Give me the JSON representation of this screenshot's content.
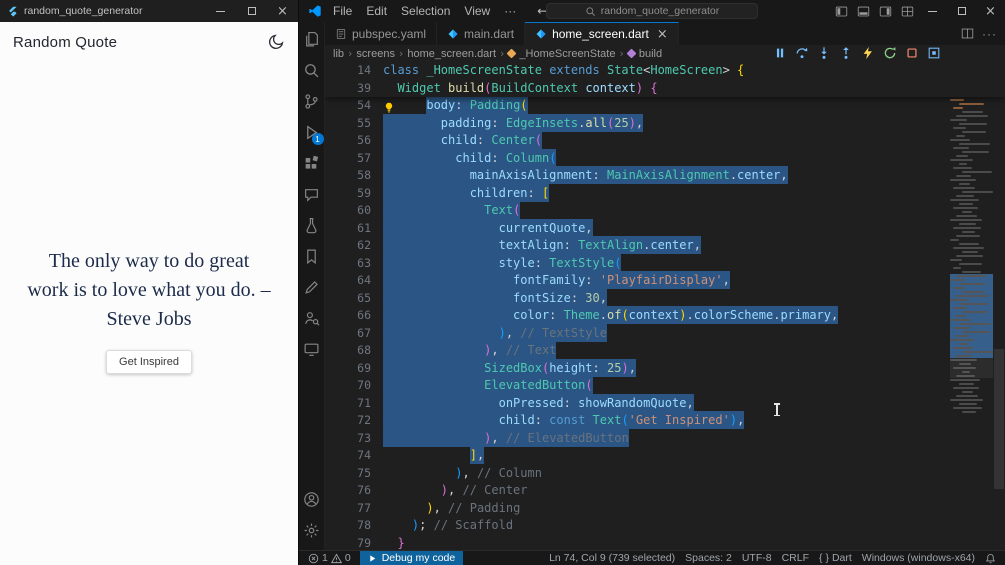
{
  "app_window": {
    "title": "random_quote_generator",
    "header_title": "Random Quote",
    "quote_lines": [
      "The only way to do great",
      "work is to love what you do. –",
      "Steve Jobs"
    ],
    "button_label": "Get Inspired"
  },
  "vscode": {
    "menus": [
      "File",
      "Edit",
      "Selection",
      "View",
      "···"
    ],
    "search_value": "random_quote_generator",
    "debug_badge": "1",
    "tabs": [
      {
        "label": "pubspec.yaml"
      },
      {
        "label": "main.dart"
      },
      {
        "label": "home_screen.dart"
      }
    ],
    "breadcrumbs": [
      "lib",
      "screens",
      "home_screen.dart",
      "_HomeScreenState",
      "build"
    ],
    "editor": {
      "syntax_colors": {
        "kw": "#569cd6",
        "ty": "#4ec9b0",
        "pr": "#9cdcfe",
        "fn": "#dcdcaa",
        "st": "#ce9178",
        "nu": "#b5cea8",
        "pu": "#d4d4d4",
        "b1": "#ffd700",
        "b2": "#da70d6",
        "b3": "#179fff",
        "cm": "#6a737d"
      },
      "sticky": [
        {
          "n": 14,
          "i": 0,
          "sel": 0,
          "t": [
            [
              "kw",
              "class "
            ],
            [
              "ty",
              "_HomeScreenState "
            ],
            [
              "kw",
              "extends "
            ],
            [
              "ty",
              "State"
            ],
            [
              "pu",
              "<"
            ],
            [
              "ty",
              "HomeScreen"
            ],
            [
              "pu",
              "> "
            ],
            [
              "b1",
              "{"
            ]
          ]
        },
        {
          "n": 39,
          "i": 2,
          "sel": 0,
          "t": [
            [
              "ty",
              "Widget "
            ],
            [
              "fn",
              "build"
            ],
            [
              "b2",
              "("
            ],
            [
              "ty",
              "BuildContext "
            ],
            [
              "pr",
              "context"
            ],
            [
              "b2",
              ") "
            ],
            [
              "b2",
              "{"
            ]
          ]
        }
      ],
      "lines": [
        {
          "n": 54,
          "i": 6,
          "sel": 2,
          "t": [
            [
              "pr",
              "body"
            ],
            [
              "pu",
              ": "
            ],
            [
              "ty",
              "Padding"
            ],
            [
              "b1",
              "("
            ]
          ]
        },
        {
          "n": 55,
          "i": 8,
          "sel": 1,
          "t": [
            [
              "pr",
              "padding"
            ],
            [
              "pu",
              ": "
            ],
            [
              "ty",
              "EdgeInsets"
            ],
            [
              "pu",
              "."
            ],
            [
              "fn",
              "all"
            ],
            [
              "b2",
              "("
            ],
            [
              "nu",
              "25"
            ],
            [
              "b2",
              ")"
            ],
            [
              "pu",
              ","
            ]
          ]
        },
        {
          "n": 56,
          "i": 8,
          "sel": 1,
          "t": [
            [
              "pr",
              "child"
            ],
            [
              "pu",
              ": "
            ],
            [
              "ty",
              "Center"
            ],
            [
              "b2",
              "("
            ]
          ]
        },
        {
          "n": 57,
          "i": 10,
          "sel": 1,
          "t": [
            [
              "pr",
              "child"
            ],
            [
              "pu",
              ": "
            ],
            [
              "ty",
              "Column"
            ],
            [
              "b3",
              "("
            ]
          ]
        },
        {
          "n": 58,
          "i": 12,
          "sel": 1,
          "t": [
            [
              "pr",
              "mainAxisAlignment"
            ],
            [
              "pu",
              ": "
            ],
            [
              "ty",
              "MainAxisAlignment"
            ],
            [
              "pu",
              "."
            ],
            [
              "pr",
              "center"
            ],
            [
              "pu",
              ","
            ]
          ]
        },
        {
          "n": 59,
          "i": 12,
          "sel": 1,
          "t": [
            [
              "pr",
              "children"
            ],
            [
              "pu",
              ": "
            ],
            [
              "b1",
              "["
            ]
          ]
        },
        {
          "n": 60,
          "i": 14,
          "sel": 1,
          "t": [
            [
              "ty",
              "Text"
            ],
            [
              "b2",
              "("
            ]
          ]
        },
        {
          "n": 61,
          "i": 16,
          "sel": 1,
          "t": [
            [
              "pr",
              "currentQuote"
            ],
            [
              "pu",
              ","
            ]
          ]
        },
        {
          "n": 62,
          "i": 16,
          "sel": 1,
          "t": [
            [
              "pr",
              "textAlign"
            ],
            [
              "pu",
              ": "
            ],
            [
              "ty",
              "TextAlign"
            ],
            [
              "pu",
              "."
            ],
            [
              "pr",
              "center"
            ],
            [
              "pu",
              ","
            ]
          ]
        },
        {
          "n": 63,
          "i": 16,
          "sel": 1,
          "t": [
            [
              "pr",
              "style"
            ],
            [
              "pu",
              ": "
            ],
            [
              "ty",
              "TextStyle"
            ],
            [
              "b3",
              "("
            ]
          ]
        },
        {
          "n": 64,
          "i": 18,
          "sel": 1,
          "t": [
            [
              "pr",
              "fontFamily"
            ],
            [
              "pu",
              ": "
            ],
            [
              "st",
              "'PlayfairDisplay'"
            ],
            [
              "pu",
              ","
            ]
          ]
        },
        {
          "n": 65,
          "i": 18,
          "sel": 1,
          "t": [
            [
              "pr",
              "fontSize"
            ],
            [
              "pu",
              ": "
            ],
            [
              "nu",
              "30"
            ],
            [
              "pu",
              ","
            ]
          ]
        },
        {
          "n": 66,
          "i": 18,
          "sel": 1,
          "t": [
            [
              "pr",
              "color"
            ],
            [
              "pu",
              ": "
            ],
            [
              "ty",
              "Theme"
            ],
            [
              "pu",
              "."
            ],
            [
              "fn",
              "of"
            ],
            [
              "b1",
              "("
            ],
            [
              "pr",
              "context"
            ],
            [
              "b1",
              ")"
            ],
            [
              "pu",
              "."
            ],
            [
              "pr",
              "colorScheme"
            ],
            [
              "pu",
              "."
            ],
            [
              "pr",
              "primary"
            ],
            [
              "pu",
              ","
            ]
          ]
        },
        {
          "n": 67,
          "i": 16,
          "sel": 1,
          "t": [
            [
              "b3",
              ")"
            ],
            [
              "pu",
              ", "
            ],
            [
              "cm",
              "// TextStyle"
            ]
          ]
        },
        {
          "n": 68,
          "i": 14,
          "sel": 1,
          "t": [
            [
              "b2",
              ")"
            ],
            [
              "pu",
              ", "
            ],
            [
              "cm",
              "// Text"
            ]
          ]
        },
        {
          "n": 69,
          "i": 14,
          "sel": 1,
          "t": [
            [
              "ty",
              "SizedBox"
            ],
            [
              "b2",
              "("
            ],
            [
              "pr",
              "height"
            ],
            [
              "pu",
              ": "
            ],
            [
              "nu",
              "25"
            ],
            [
              "b2",
              ")"
            ],
            [
              "pu",
              ","
            ]
          ]
        },
        {
          "n": 70,
          "i": 14,
          "sel": 1,
          "t": [
            [
              "ty",
              "ElevatedButton"
            ],
            [
              "b2",
              "("
            ]
          ]
        },
        {
          "n": 71,
          "i": 16,
          "sel": 1,
          "t": [
            [
              "pr",
              "onPressed"
            ],
            [
              "pu",
              ": "
            ],
            [
              "pr",
              "showRandomQuote"
            ],
            [
              "pu",
              ","
            ]
          ]
        },
        {
          "n": 72,
          "i": 16,
          "sel": 1,
          "t": [
            [
              "pr",
              "child"
            ],
            [
              "pu",
              ": "
            ],
            [
              "kw",
              "const "
            ],
            [
              "ty",
              "Text"
            ],
            [
              "b3",
              "("
            ],
            [
              "st",
              "'Get Inspired'"
            ],
            [
              "b3",
              ")"
            ],
            [
              "pu",
              ","
            ]
          ]
        },
        {
          "n": 73,
          "i": 14,
          "sel": 1,
          "t": [
            [
              "b2",
              ")"
            ],
            [
              "pu",
              ", "
            ],
            [
              "cm",
              "// ElevatedButton"
            ]
          ]
        },
        {
          "n": 74,
          "i": 12,
          "sel": 2,
          "t": [
            [
              "b1",
              "]"
            ],
            [
              "pu",
              ","
            ]
          ]
        },
        {
          "n": 75,
          "i": 10,
          "sel": 0,
          "t": [
            [
              "b3",
              ")"
            ],
            [
              "pu",
              ", "
            ],
            [
              "cm",
              "// Column"
            ]
          ]
        },
        {
          "n": 76,
          "i": 8,
          "sel": 0,
          "t": [
            [
              "b2",
              ")"
            ],
            [
              "pu",
              ", "
            ],
            [
              "cm",
              "// Center"
            ]
          ]
        },
        {
          "n": 77,
          "i": 6,
          "sel": 0,
          "t": [
            [
              "b1",
              ")"
            ],
            [
              "pu",
              ", "
            ],
            [
              "cm",
              "// Padding"
            ]
          ]
        },
        {
          "n": 78,
          "i": 4,
          "sel": 0,
          "t": [
            [
              "b3",
              ")"
            ],
            [
              "pu",
              "; "
            ],
            [
              "cm",
              "// Scaffold"
            ]
          ]
        },
        {
          "n": 79,
          "i": 2,
          "sel": 0,
          "t": [
            [
              "b2",
              "}"
            ]
          ]
        }
      ]
    },
    "statusbar": {
      "errors": "1",
      "warnings": "0",
      "debug_label": "Debug my code",
      "position": "Ln 74, Col 9 (739 selected)",
      "indent": "Spaces: 2",
      "encoding": "UTF-8",
      "eol": "CRLF",
      "lang_icon": "{ }",
      "language": "Dart",
      "device": "Windows (windows-x64)"
    }
  },
  "colors": {
    "accent": "#0078d4",
    "selection": "#2a5584",
    "hot_reload": "#ffd54f",
    "restart": "#89d185",
    "stop": "#f48771",
    "quote_text": "#1c2b4a"
  }
}
